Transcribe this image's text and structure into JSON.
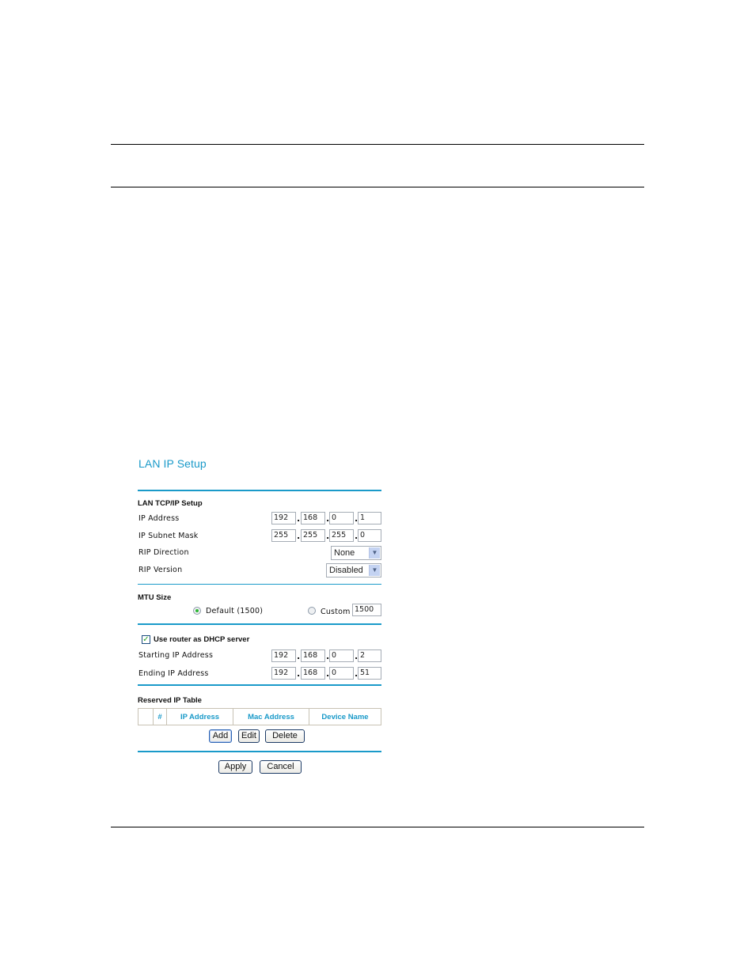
{
  "page": {
    "rules": [
      "top",
      "upper",
      "bottom"
    ]
  },
  "panel": {
    "title": "LAN IP Setup",
    "lan_section": {
      "heading": "LAN TCP/IP Setup",
      "ip_address": {
        "label": "IP Address",
        "octets": [
          "192",
          "168",
          "0",
          "1"
        ]
      },
      "subnet_mask": {
        "label": "IP Subnet Mask",
        "octets": [
          "255",
          "255",
          "255",
          "0"
        ]
      },
      "rip_direction": {
        "label": "RIP Direction",
        "selected": "None"
      },
      "rip_version": {
        "label": "RIP Version",
        "selected": "Disabled"
      }
    },
    "mtu_section": {
      "heading": "MTU Size",
      "default_option": {
        "label": "Default (1500)",
        "checked": true
      },
      "custom_option": {
        "label": "Custom",
        "checked": false,
        "value": "1500"
      }
    },
    "dhcp_section": {
      "checkbox_label": "Use router as DHCP server",
      "checked": true,
      "start": {
        "label": "Starting IP Address",
        "octets": [
          "192",
          "168",
          "0",
          "2"
        ]
      },
      "end": {
        "label": "Ending IP Address",
        "octets": [
          "192",
          "168",
          "0",
          "51"
        ]
      }
    },
    "reserved_section": {
      "heading": "Reserved IP Table",
      "columns": [
        "",
        "#",
        "IP Address",
        "Mac Address",
        "Device Name"
      ],
      "buttons": {
        "add": "Add",
        "edit": "Edit",
        "delete": "Delete"
      }
    },
    "footer_buttons": {
      "apply": "Apply",
      "cancel": "Cancel"
    },
    "colors": {
      "accent": "#1a9ac9",
      "check": "#2db734"
    }
  }
}
